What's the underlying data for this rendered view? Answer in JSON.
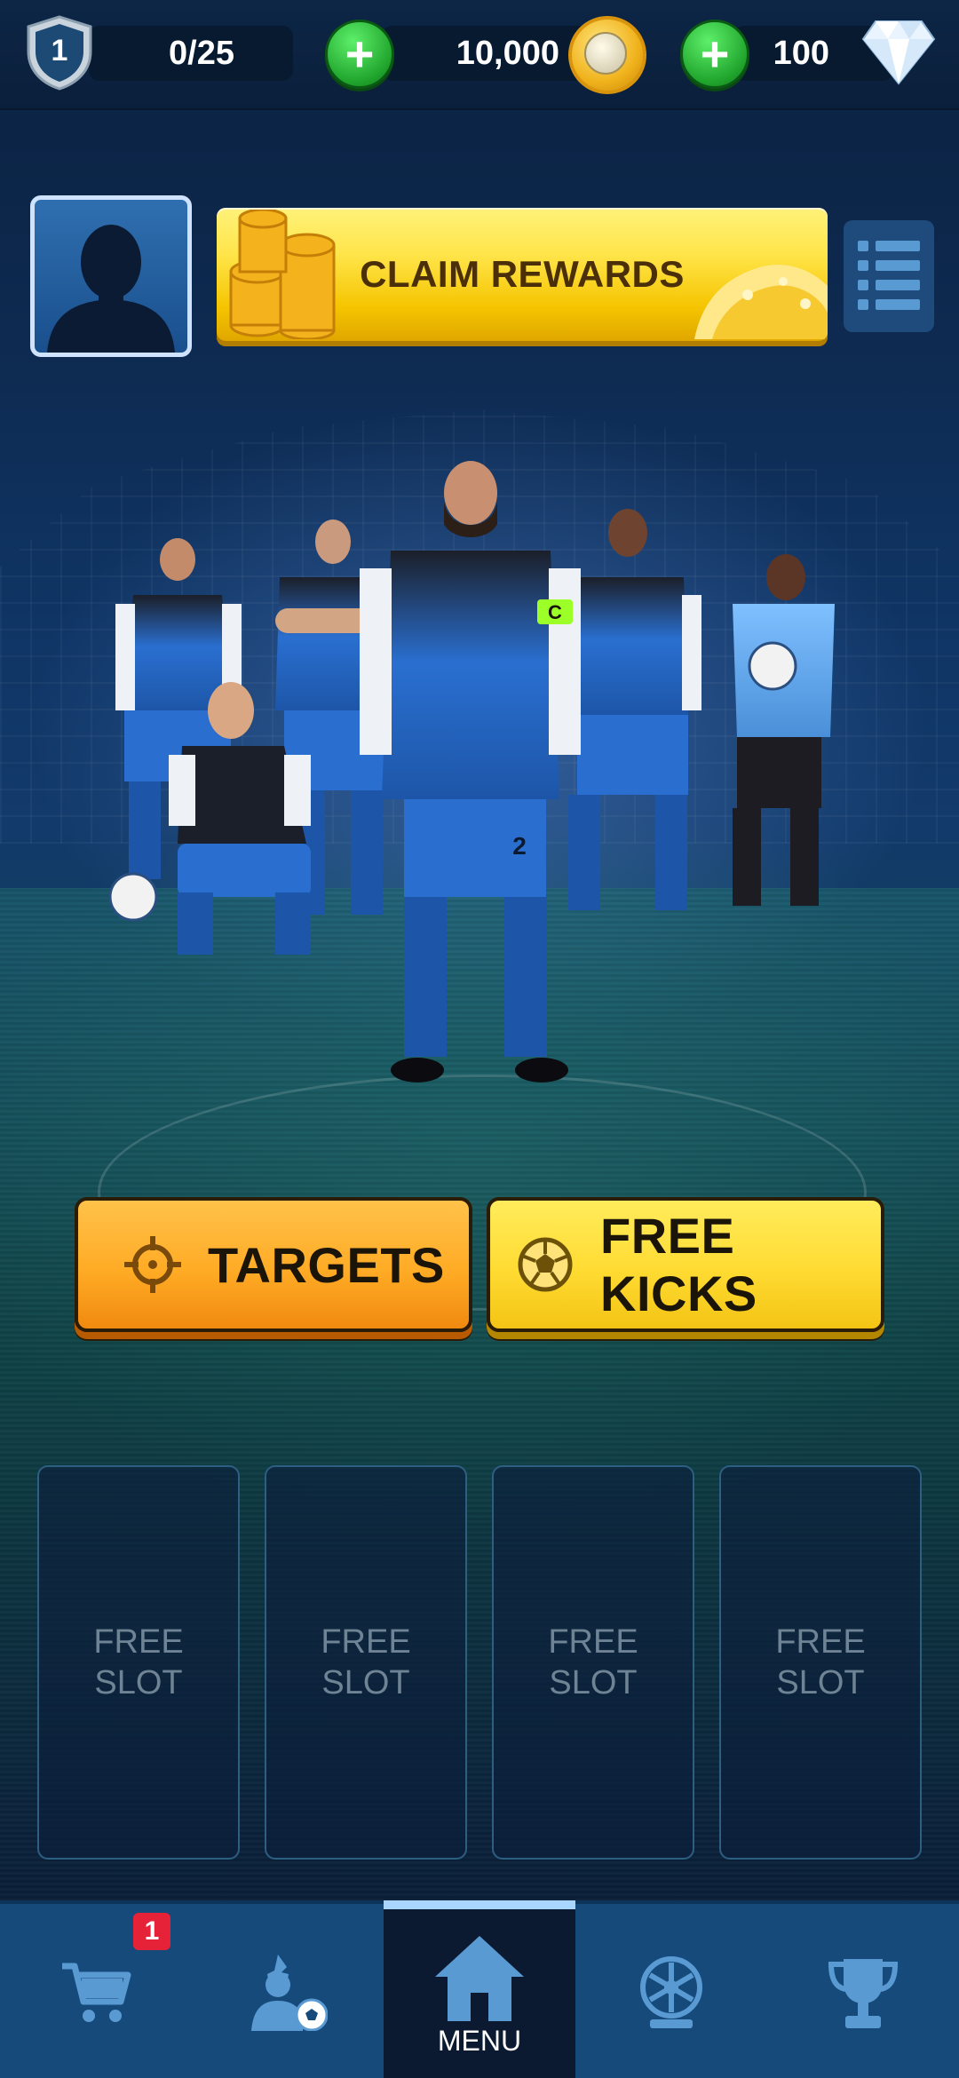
{
  "topbar": {
    "level": "1",
    "xp": "0/25",
    "coins": "10,000",
    "gems": "100",
    "add_coins_icon": "plus-icon",
    "add_gems_icon": "plus-icon"
  },
  "profile": {
    "avatar_icon": "player-silhouette-icon",
    "claim_label": "CLAIM REWARDS",
    "list_icon": "list-icon"
  },
  "squad": {
    "captain_number": "2",
    "captain_armband": "C"
  },
  "modes": {
    "targets_label": "TARGETS",
    "targets_icon": "crosshair-icon",
    "free_kicks_label": "FREE KICKS",
    "free_kicks_icon": "football-icon"
  },
  "slots": [
    {
      "line1": "FREE",
      "line2": "SLOT"
    },
    {
      "line1": "FREE",
      "line2": "SLOT"
    },
    {
      "line1": "FREE",
      "line2": "SLOT"
    },
    {
      "line1": "FREE",
      "line2": "SLOT"
    }
  ],
  "nav": {
    "shop_icon": "cart-icon",
    "shop_badge": "1",
    "team_icon": "player-ball-icon",
    "menu_icon": "home-icon",
    "menu_label": "MENU",
    "spin_icon": "prize-wheel-icon",
    "trophy_icon": "trophy-icon"
  },
  "colors": {
    "claim_gold": "#f5c400",
    "targets_orange": "#ffab25",
    "free_kicks_yellow": "#ffdb32",
    "nav_blue": "#154a7a",
    "nav_active": "#0b1a30",
    "badge_red": "#e52238",
    "plus_green": "#1fa32c"
  }
}
